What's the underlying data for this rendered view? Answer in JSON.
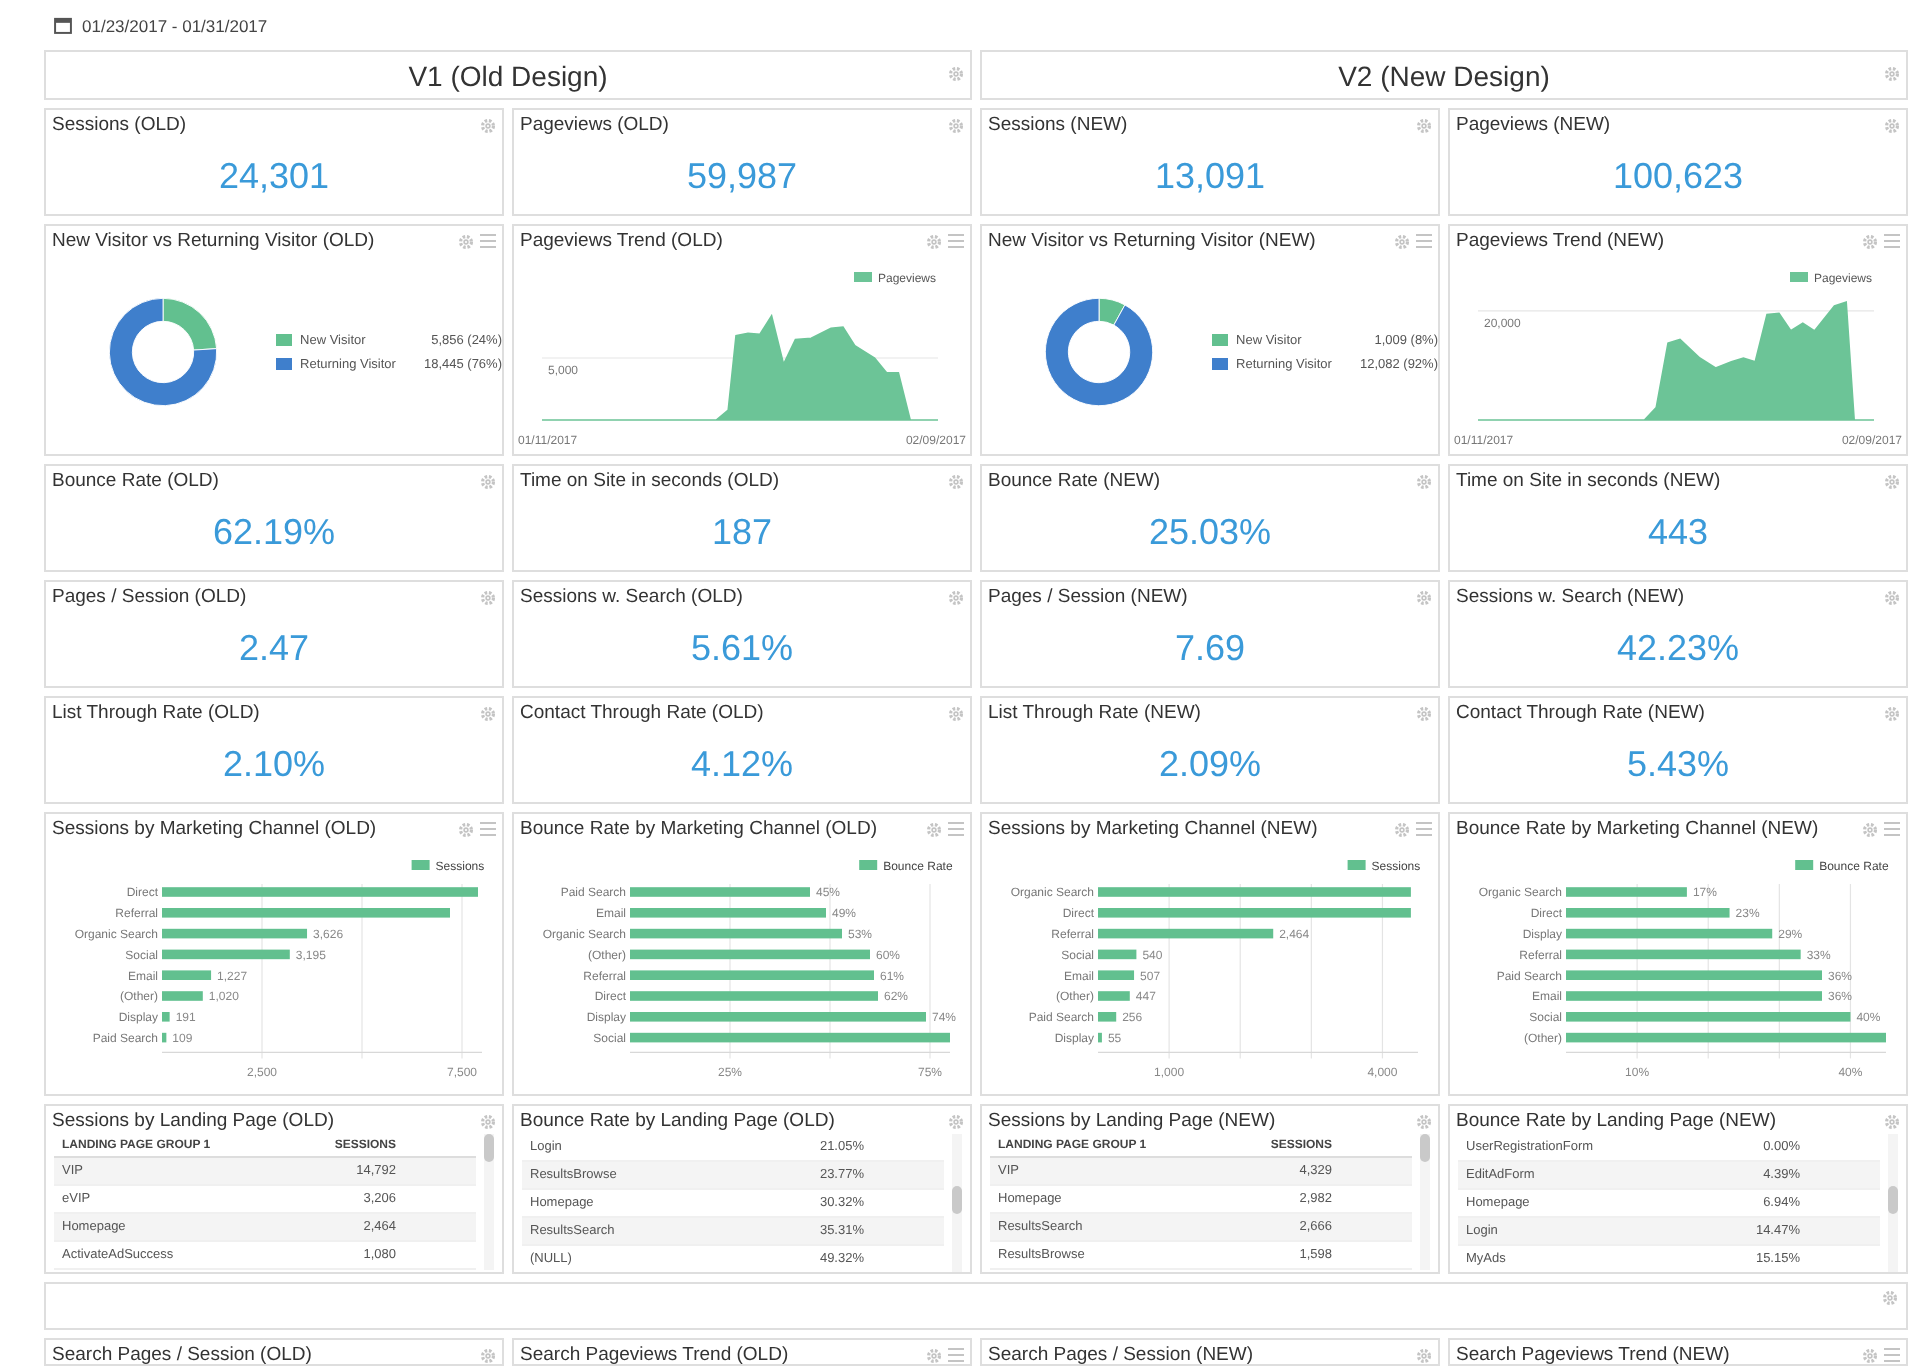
{
  "date_range": "01/23/2017 - 01/31/2017",
  "sections": [
    {
      "title": "V1 (Old Design)"
    },
    {
      "title": "V2 (New Design)"
    }
  ],
  "widgets": [
    {
      "kind": "metric",
      "title": "Sessions (OLD)",
      "value": "24,301"
    },
    {
      "kind": "metric",
      "title": "Pageviews (OLD)",
      "value": "59,987"
    },
    {
      "kind": "metric",
      "title": "Sessions (NEW)",
      "value": "13,091"
    },
    {
      "kind": "metric",
      "title": "Pageviews (NEW)",
      "value": "100,623"
    },
    {
      "kind": "donut",
      "title": "New Visitor vs Returning Visitor (OLD)",
      "chart_data": {
        "type": "donut",
        "categories": [
          "New Visitor",
          "Returning Visitor"
        ],
        "values": [
          24,
          76
        ]
      },
      "legend": [
        {
          "value": "5,856 (24%)",
          "color": "#62c08f"
        },
        {
          "value": "18,445 (76%)",
          "color": "#3f7fcc"
        }
      ]
    },
    {
      "kind": "trend",
      "title": "Pageviews Trend (OLD)",
      "series": "Pageviews",
      "color": "#6cc497",
      "y_label": "5,000",
      "x_start": "01/11/2017",
      "x_end": "02/09/2017"
    },
    {
      "kind": "donut",
      "title": "New Visitor vs Returning Visitor (NEW)",
      "chart_data": {
        "type": "donut",
        "categories": [
          "New Visitor",
          "Returning Visitor"
        ],
        "values": [
          8,
          92
        ]
      },
      "legend": [
        {
          "value": "1,009 (8%)",
          "color": "#62c08f"
        },
        {
          "value": "12,082 (92%)",
          "color": "#3f7fcc"
        }
      ]
    },
    {
      "kind": "trend",
      "title": "Pageviews Trend (NEW)",
      "series": "Pageviews",
      "color": "#6cc497",
      "y_label": "20,000",
      "x_start": "01/11/2017",
      "x_end": "02/09/2017"
    },
    {
      "kind": "metric",
      "title": "Bounce Rate (OLD)",
      "value": "62.19%"
    },
    {
      "kind": "metric",
      "title": "Time on Site in seconds (OLD)",
      "value": "187"
    },
    {
      "kind": "metric",
      "title": "Bounce Rate (NEW)",
      "value": "25.03%"
    },
    {
      "kind": "metric",
      "title": "Time on Site in seconds (NEW)",
      "value": "443"
    },
    {
      "kind": "metric",
      "title": "Pages / Session (OLD)",
      "value": "2.47"
    },
    {
      "kind": "metric",
      "title": "Sessions w. Search (OLD)",
      "value": "5.61%"
    },
    {
      "kind": "metric",
      "title": "Pages / Session (NEW)",
      "value": "7.69"
    },
    {
      "kind": "metric",
      "title": "Sessions w. Search (NEW)",
      "value": "42.23%"
    },
    {
      "kind": "metric",
      "title": "List Through Rate (OLD)",
      "value": "2.10%"
    },
    {
      "kind": "metric",
      "title": "Contact Through Rate (OLD)",
      "value": "4.12%"
    },
    {
      "kind": "metric",
      "title": "List Through Rate (NEW)",
      "value": "2.09%"
    },
    {
      "kind": "metric",
      "title": "Contact Through Rate (NEW)",
      "value": "5.43%"
    },
    {
      "kind": "bar",
      "title": "Sessions by Marketing Channel (OLD)",
      "chart_data": {
        "type": "bar",
        "orientation": "horizontal",
        "categories": [
          "Direct",
          "Referral",
          "Organic Search",
          "Social",
          "Email",
          "(Other)",
          "Display",
          "Paid Search"
        ],
        "series": [
          {
            "name": "Sessions",
            "color": "#62c08f",
            "values": [
              7900,
              7200,
              3626,
              3195,
              1227,
              1020,
              191,
              109
            ]
          }
        ],
        "xlim": [
          0,
          8000
        ],
        "xticks": [
          {
            "value": 2500,
            "label": "2,500"
          },
          {
            "value": 7500,
            "label": "7,500"
          }
        ],
        "value_labels": [
          null,
          null,
          "3,626",
          "3,195",
          "1,227",
          "1,020",
          "191",
          "109"
        ]
      }
    },
    {
      "kind": "bar",
      "title": "Bounce Rate by Marketing Channel (OLD)",
      "chart_data": {
        "type": "bar",
        "orientation": "horizontal",
        "categories": [
          "Paid Search",
          "Email",
          "Organic Search",
          "(Other)",
          "Referral",
          "Direct",
          "Display",
          "Social"
        ],
        "series": [
          {
            "name": "Bounce Rate",
            "color": "#62c08f",
            "values": [
              45,
              49,
              53,
              60,
              61,
              62,
              74,
              80
            ]
          }
        ],
        "xlim": [
          0,
          80
        ],
        "xticks": [
          {
            "value": 25,
            "label": "25%"
          },
          {
            "value": 75,
            "label": "75%"
          }
        ],
        "value_labels": [
          "45%",
          "49%",
          "53%",
          "60%",
          "61%",
          "62%",
          "74%",
          null
        ]
      }
    },
    {
      "kind": "bar",
      "title": "Sessions by Marketing Channel (NEW)",
      "chart_data": {
        "type": "bar",
        "orientation": "horizontal",
        "categories": [
          "Organic Search",
          "Direct",
          "Referral",
          "Social",
          "Email",
          "(Other)",
          "Paid Search",
          "Display"
        ],
        "series": [
          {
            "name": "Sessions",
            "color": "#62c08f",
            "values": [
              4400,
              4400,
              2464,
              540,
              507,
              447,
              256,
              55
            ]
          }
        ],
        "xlim": [
          0,
          4500
        ],
        "xticks": [
          {
            "value": 1000,
            "label": "1,000"
          },
          {
            "value": 4000,
            "label": "4,000"
          }
        ],
        "value_labels": [
          null,
          null,
          "2,464",
          "540",
          "507",
          "447",
          "256",
          "55"
        ]
      }
    },
    {
      "kind": "bar",
      "title": "Bounce Rate by Marketing Channel (NEW)",
      "chart_data": {
        "type": "bar",
        "orientation": "horizontal",
        "categories": [
          "Organic Search",
          "Direct",
          "Display",
          "Referral",
          "Paid Search",
          "Email",
          "Social",
          "(Other)"
        ],
        "series": [
          {
            "name": "Bounce Rate",
            "color": "#62c08f",
            "values": [
              17,
              23,
              29,
              33,
              36,
              36,
              40,
              45
            ]
          }
        ],
        "xlim": [
          0,
          45
        ],
        "xticks": [
          {
            "value": 10,
            "label": "10%"
          },
          {
            "value": 40,
            "label": "40%"
          }
        ],
        "value_labels": [
          "17%",
          "23%",
          "29%",
          "33%",
          "36%",
          "36%",
          "40%",
          null
        ]
      }
    },
    {
      "kind": "table",
      "title": "Sessions by Landing Page (OLD)",
      "columns": [
        "LANDING PAGE GROUP 1",
        "SESSIONS"
      ],
      "rows": [
        [
          "VIP",
          "14,792"
        ],
        [
          "eVIP",
          "3,206"
        ],
        [
          "Homepage",
          "2,464"
        ],
        [
          "ActivateAdSuccess",
          "1,080"
        ]
      ]
    },
    {
      "kind": "table",
      "title": "Bounce Rate by Landing Page (OLD)",
      "rows": [
        [
          "Login",
          "21.05%"
        ],
        [
          "ResultsBrowse",
          "23.77%"
        ],
        [
          "Homepage",
          "30.32%"
        ],
        [
          "ResultsSearch",
          "35.31%"
        ],
        [
          "(NULL)",
          "49.32%"
        ]
      ]
    },
    {
      "kind": "table",
      "title": "Sessions by Landing Page (NEW)",
      "columns": [
        "LANDING PAGE GROUP 1",
        "SESSIONS"
      ],
      "rows": [
        [
          "VIP",
          "4,329"
        ],
        [
          "Homepage",
          "2,982"
        ],
        [
          "ResultsSearch",
          "2,666"
        ],
        [
          "ResultsBrowse",
          "1,598"
        ]
      ]
    },
    {
      "kind": "table",
      "title": "Bounce Rate by Landing Page (NEW)",
      "rows": [
        [
          "UserRegistrationForm",
          "0.00%"
        ],
        [
          "EditAdForm",
          "4.39%"
        ],
        [
          "Homepage",
          "6.94%"
        ],
        [
          "Login",
          "14.47%"
        ],
        [
          "MyAds",
          "15.15%"
        ]
      ]
    }
  ],
  "partial_widgets": [
    {
      "kind": "metric",
      "title": "Search Pages / Session (OLD)"
    },
    {
      "kind": "trend",
      "title": "Search Pageviews Trend (OLD)"
    },
    {
      "kind": "metric",
      "title": "Search Pages / Session (NEW)"
    },
    {
      "kind": "trend",
      "title": "Search Pageviews Trend (NEW)"
    }
  ]
}
